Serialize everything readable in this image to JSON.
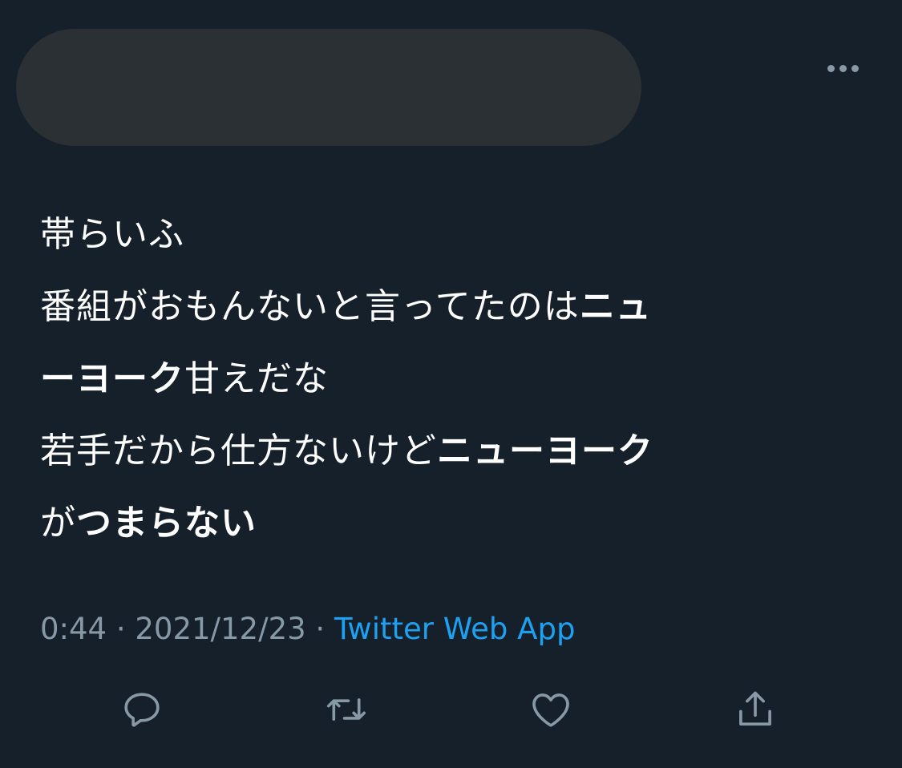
{
  "tweet": {
    "lines": [
      [
        {
          "t": "帯らいふ",
          "b": false
        }
      ],
      [
        {
          "t": "番組がおもんないと言ってたのは",
          "b": false
        },
        {
          "t": "ニュ",
          "b": true
        }
      ],
      [
        {
          "t": "ーヨーク",
          "b": true
        },
        {
          "t": "甘えだな",
          "b": false
        }
      ],
      [
        {
          "t": "若手だから仕方ないけど",
          "b": false
        },
        {
          "t": "ニューヨーク",
          "b": true
        }
      ],
      [
        {
          "t": "が",
          "b": false
        },
        {
          "t": "つまらない",
          "b": true
        }
      ]
    ]
  },
  "meta": {
    "time": "0:44",
    "sep1": " · ",
    "date": "2021/12/23",
    "sep2": " · ",
    "source": "Twitter Web App"
  },
  "icons": {
    "more": "more-options-icon",
    "reply": "reply-icon",
    "retweet": "retweet-icon",
    "like": "like-icon",
    "share": "share-icon"
  },
  "colors": {
    "background": "#15202b",
    "text": "#ffffff",
    "muted": "#8899a6",
    "link": "#1da1f2",
    "redaction": "#2b3035"
  }
}
